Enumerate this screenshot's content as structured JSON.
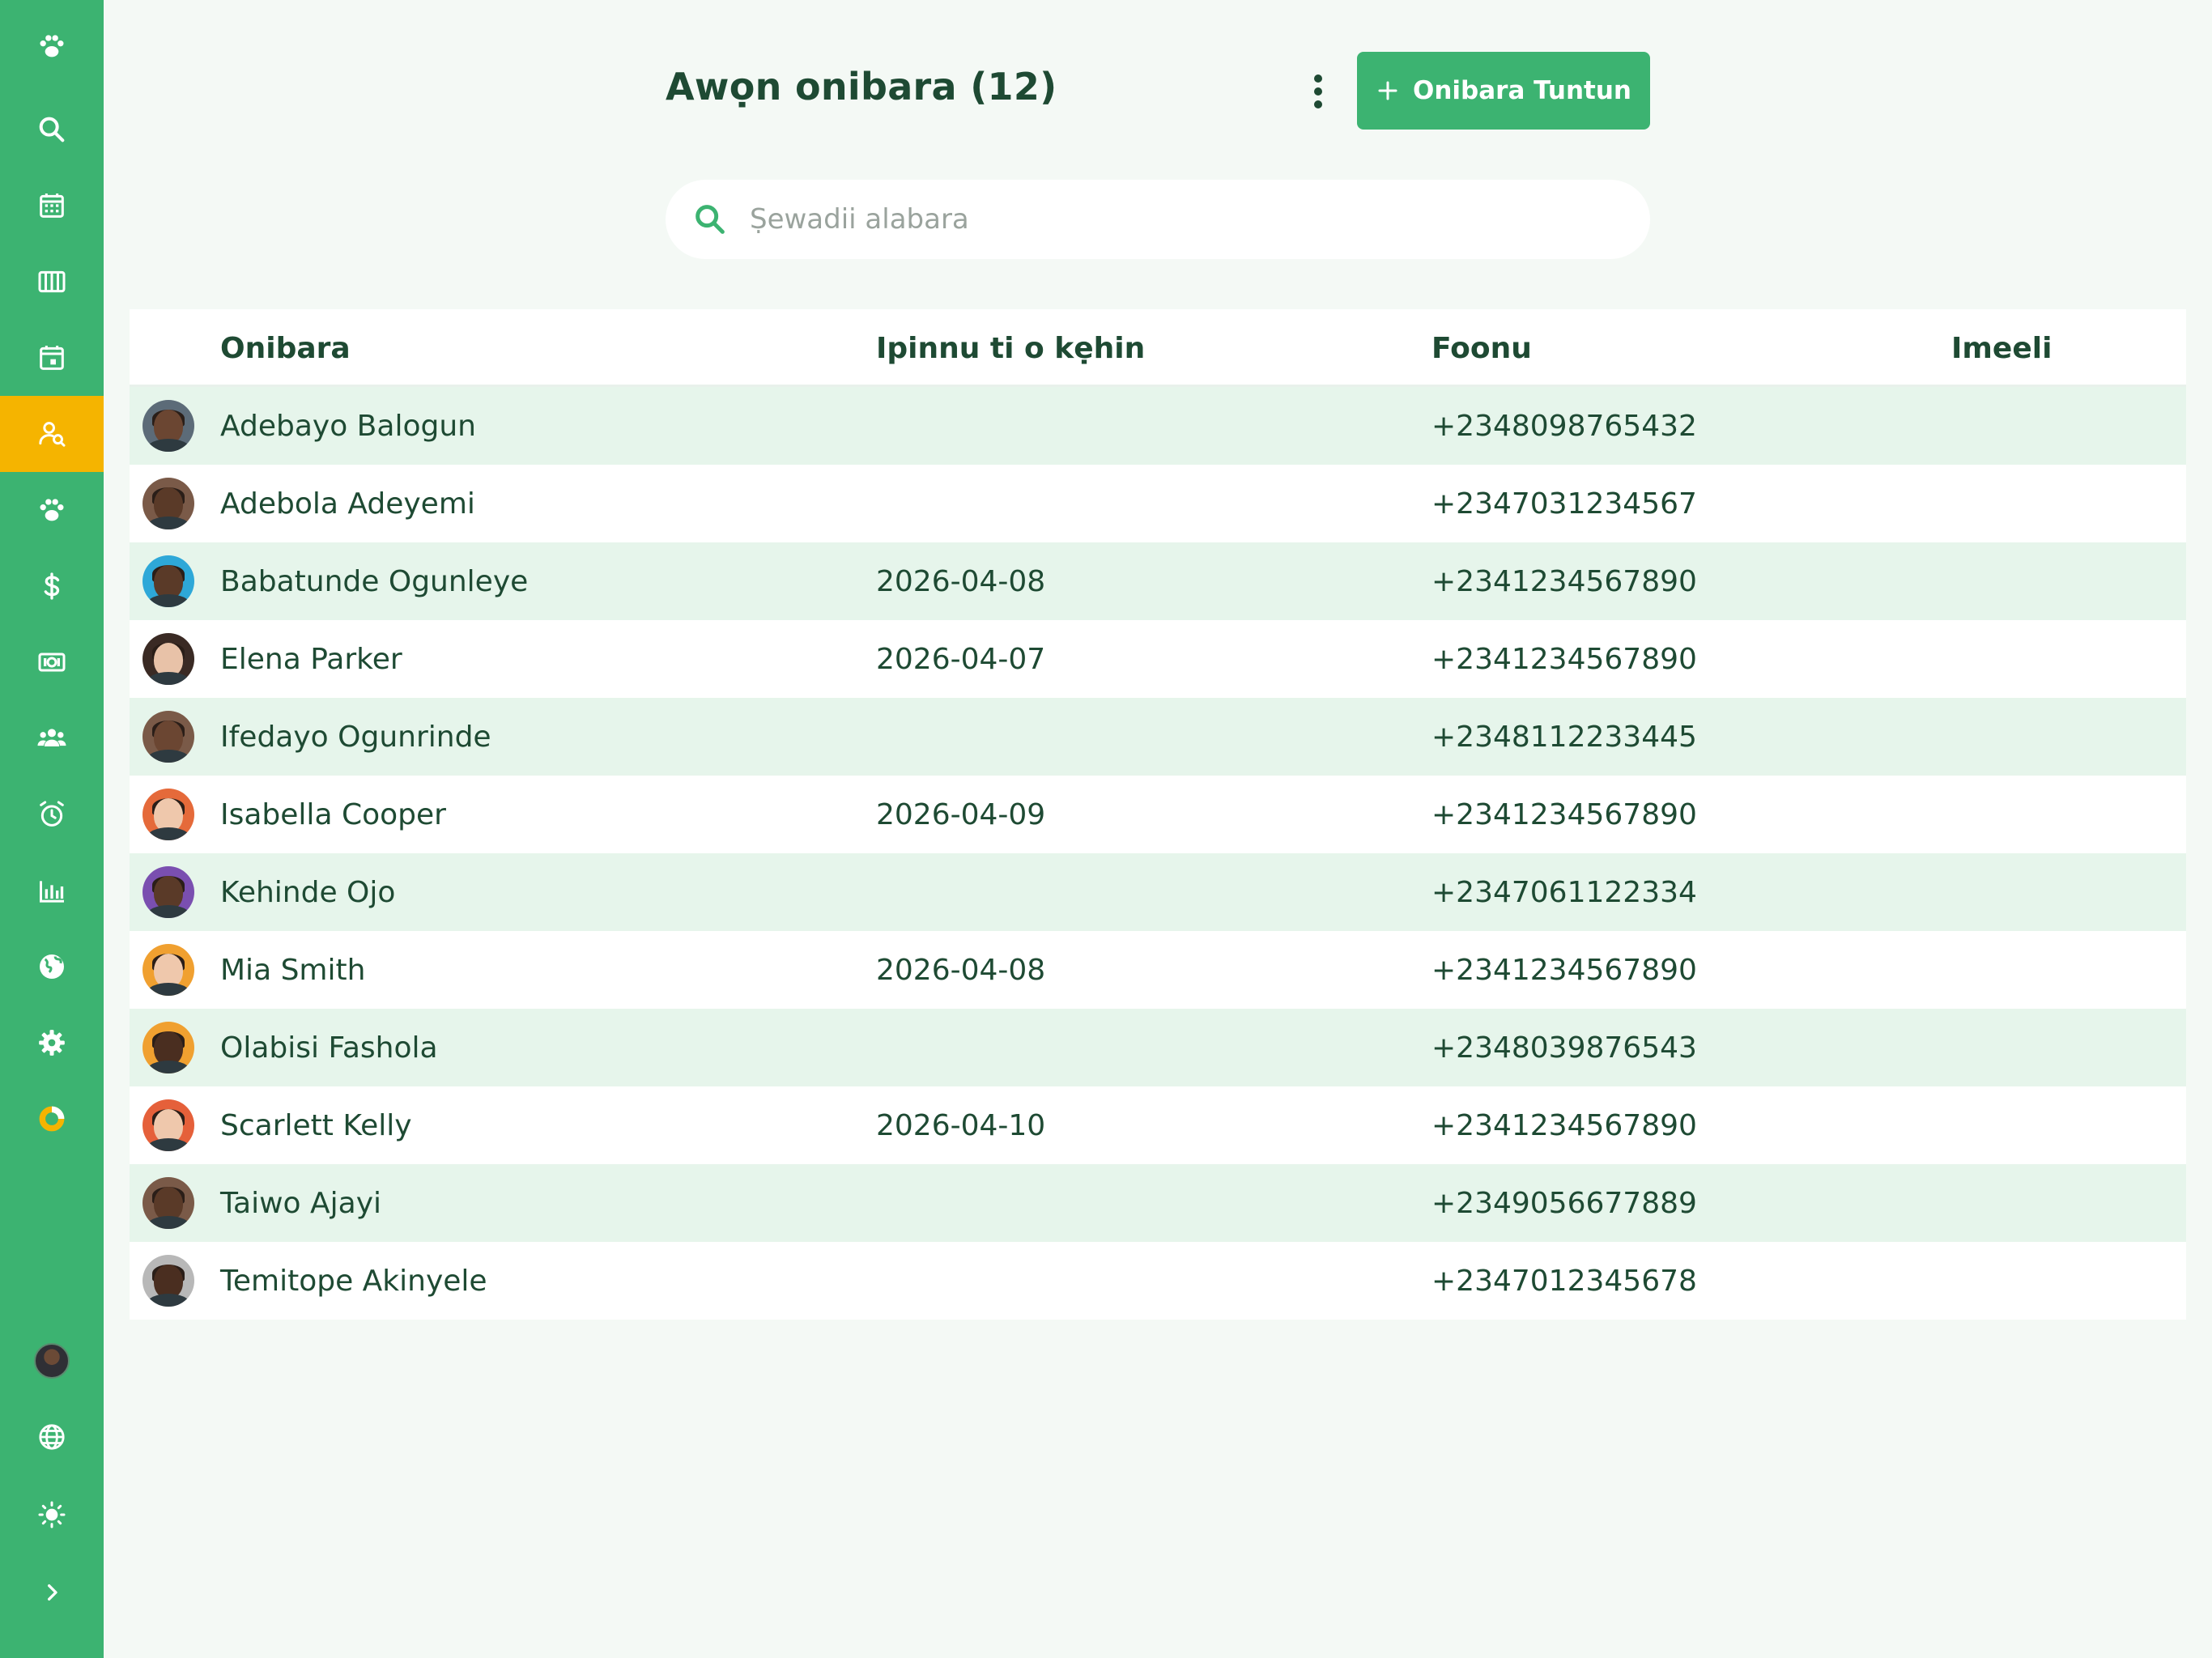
{
  "header": {
    "title": "Awọn onibara (12)",
    "add_button_label": "Onibara Tuntun"
  },
  "search": {
    "placeholder": "Ṣewadii alabara"
  },
  "table": {
    "columns": [
      "Onibara",
      "Ipinnu ti o kẹhin",
      "Foonu",
      "Imeeli"
    ],
    "rows": [
      {
        "name": "Adebayo Balogun",
        "last_appointment": "",
        "phone": "+2348098765432",
        "email": "",
        "ring": "#5c6b78",
        "skin": "#6b4632"
      },
      {
        "name": "Adebola Adeyemi",
        "last_appointment": "",
        "phone": "+2347031234567",
        "email": "",
        "ring": "#7a5a48",
        "skin": "#5a3a28"
      },
      {
        "name": "Babatunde Ogunleye",
        "last_appointment": "2026-04-08",
        "phone": "+2341234567890",
        "email": "",
        "ring": "#2ea8d8",
        "skin": "#5a3a28"
      },
      {
        "name": "Elena Parker",
        "last_appointment": "2026-04-07",
        "phone": "+2341234567890",
        "email": "",
        "ring": "#3a2a24",
        "skin": "#e8c2a8"
      },
      {
        "name": "Ifedayo Ogunrinde",
        "last_appointment": "",
        "phone": "+2348112233445",
        "email": "",
        "ring": "#7a5a48",
        "skin": "#6b4632"
      },
      {
        "name": "Isabella Cooper",
        "last_appointment": "2026-04-09",
        "phone": "+2341234567890",
        "email": "",
        "ring": "#e56a3a",
        "skin": "#efc8ac"
      },
      {
        "name": "Kehinde Ojo",
        "last_appointment": "",
        "phone": "+2347061122334",
        "email": "",
        "ring": "#7a4fb0",
        "skin": "#5a3a28"
      },
      {
        "name": "Mia Smith",
        "last_appointment": "2026-04-08",
        "phone": "+2341234567890",
        "email": "",
        "ring": "#f0a030",
        "skin": "#efc8ac"
      },
      {
        "name": "Olabisi Fashola",
        "last_appointment": "",
        "phone": "+2348039876543",
        "email": "",
        "ring": "#f0a030",
        "skin": "#4a2e20"
      },
      {
        "name": "Scarlett Kelly",
        "last_appointment": "2026-04-10",
        "phone": "+2341234567890",
        "email": "",
        "ring": "#e5603a",
        "skin": "#efc8ac"
      },
      {
        "name": "Taiwo Ajayi",
        "last_appointment": "",
        "phone": "+2349056677889",
        "email": "",
        "ring": "#7a5a48",
        "skin": "#5a3a28"
      },
      {
        "name": "Temitope Akinyele",
        "last_appointment": "",
        "phone": "+2347012345678",
        "email": "",
        "ring": "#b8b8b8",
        "skin": "#4a2e20"
      }
    ]
  },
  "sidebar": {
    "items": [
      {
        "icon": "paw-icon",
        "active": false
      },
      {
        "icon": "search-icon",
        "active": false
      },
      {
        "icon": "calendar-grid-icon",
        "active": false
      },
      {
        "icon": "columns-icon",
        "active": false
      },
      {
        "icon": "calendar-day-icon",
        "active": false
      },
      {
        "icon": "user-search-icon",
        "active": true
      },
      {
        "icon": "paw-icon",
        "active": false
      },
      {
        "icon": "dollar-icon",
        "active": false
      },
      {
        "icon": "cash-icon",
        "active": false
      },
      {
        "icon": "group-icon",
        "active": false
      },
      {
        "icon": "alarm-icon",
        "active": false
      },
      {
        "icon": "bar-chart-icon",
        "active": false
      },
      {
        "icon": "globe-filled-icon",
        "active": false
      },
      {
        "icon": "gear-icon",
        "active": false
      },
      {
        "icon": "donut-icon",
        "active": false
      }
    ],
    "bottom": [
      {
        "icon": "avatar"
      },
      {
        "icon": "globe-icon"
      },
      {
        "icon": "sun-icon"
      },
      {
        "icon": "chevron-right-icon"
      }
    ]
  },
  "colors": {
    "sidebar": "#3cb371",
    "active": "#f5b400",
    "text": "#1e4a33",
    "row_alt": "#e6f5eb",
    "background": "#f4f9f5"
  }
}
